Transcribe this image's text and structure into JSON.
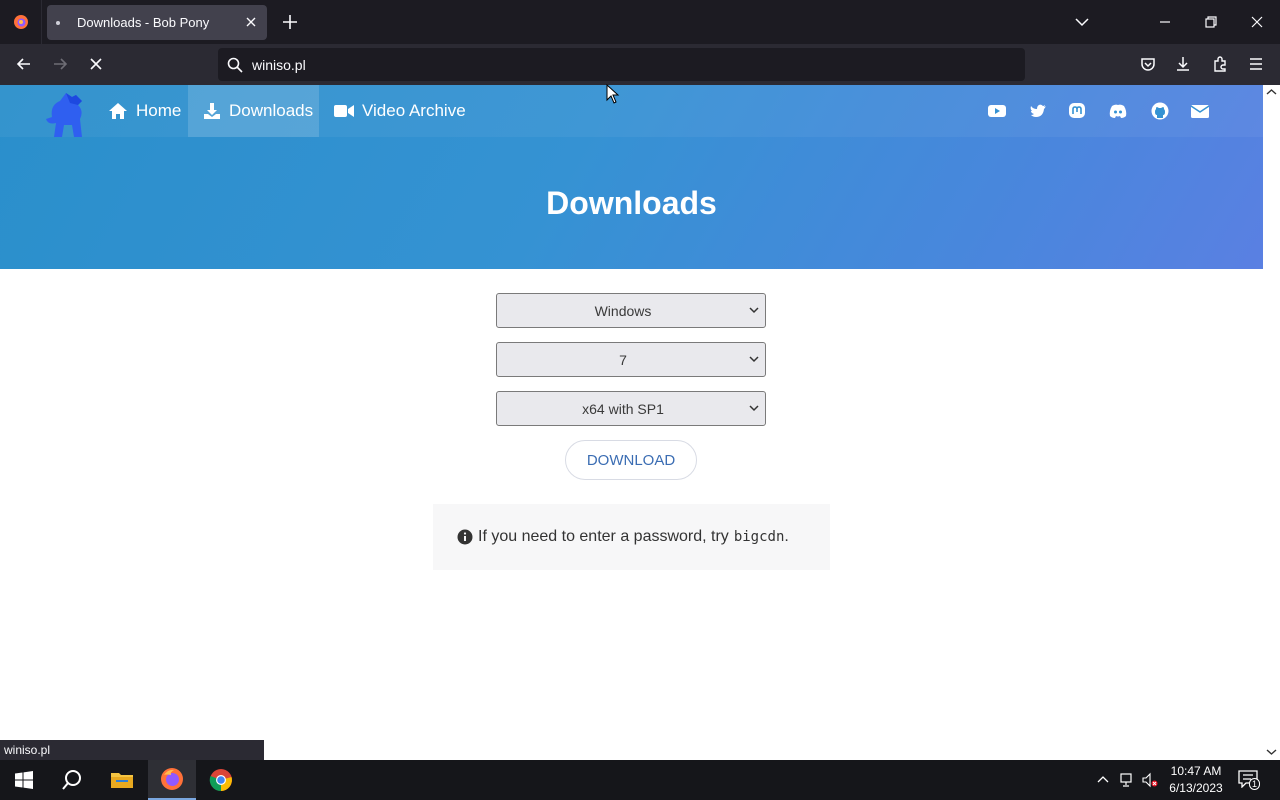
{
  "browser": {
    "tab_title": "Downloads - Bob Pony",
    "url": "winiso.pl",
    "status_text": "winiso.pl"
  },
  "site_nav": {
    "links": [
      "Home",
      "Downloads",
      "Video Archive"
    ],
    "social_icons": [
      "youtube-icon",
      "twitter-icon",
      "mastodon-icon",
      "discord-icon",
      "github-icon",
      "email-icon"
    ]
  },
  "hero": {
    "title": "Downloads"
  },
  "form": {
    "os_value": "Windows",
    "version_value": "7",
    "edition_value": "x64 with SP1",
    "download_label": "DOWNLOAD"
  },
  "note": {
    "text": "If you need to enter a password, try",
    "code": "bigcdn",
    "suffix": "."
  },
  "taskbar": {
    "time": "10:47 AM",
    "date": "6/13/2023",
    "notification_count": "1"
  },
  "colors": {
    "hero_start": "#2a8fcb",
    "hero_end": "#5a80e2",
    "button_text": "#3b6db3"
  }
}
